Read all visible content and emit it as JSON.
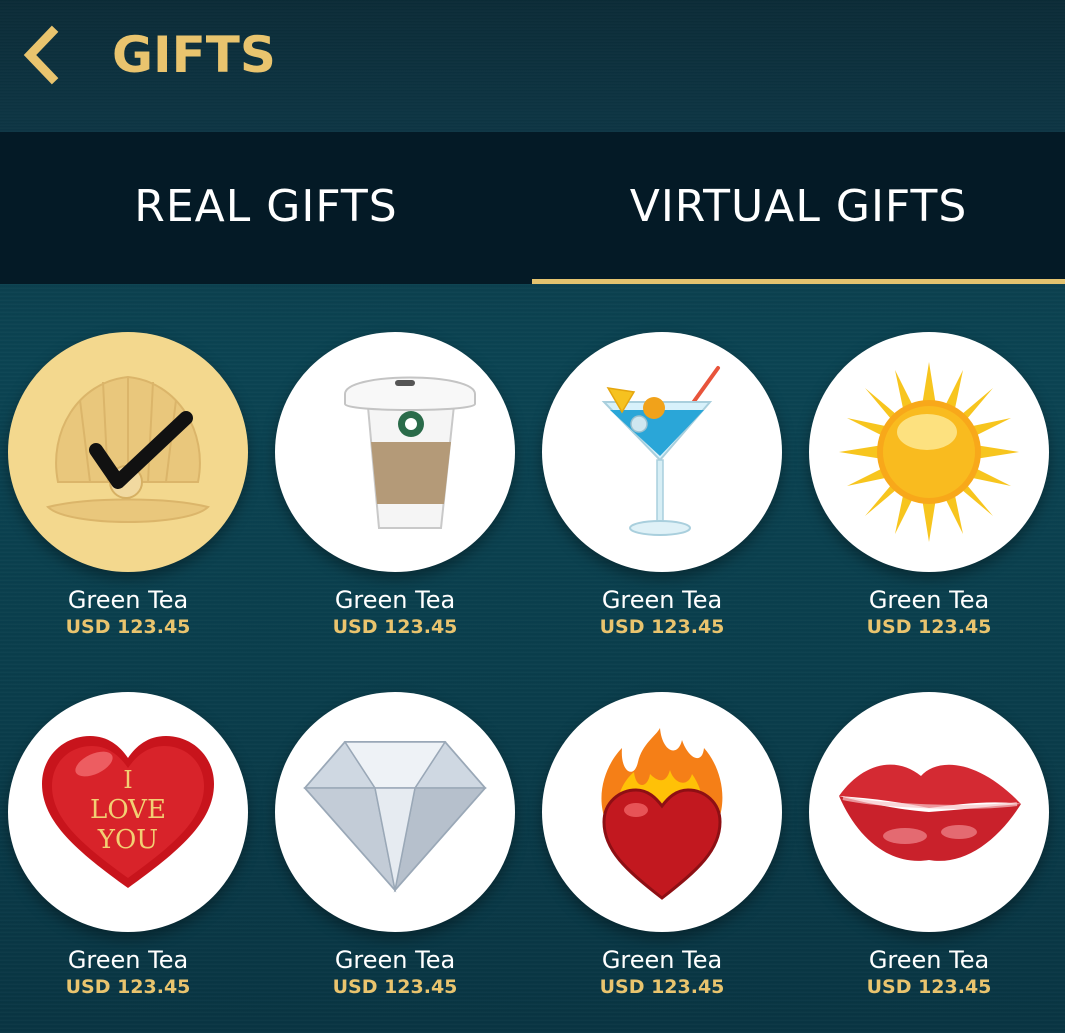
{
  "header": {
    "title": "GIFTS",
    "back_icon": "chevron-left-icon",
    "accent_color": "#e9c46e"
  },
  "tabs": [
    {
      "label": "REAL GIFTS",
      "active": false
    },
    {
      "label": "VIRTUAL GIFTS",
      "active": true
    }
  ],
  "gifts": [
    {
      "icon": "pearl-shell-icon",
      "name": "Green Tea",
      "price": "USD 123.45",
      "selected": true
    },
    {
      "icon": "coffee-cup-icon",
      "name": "Green Tea",
      "price": "USD 123.45",
      "selected": false
    },
    {
      "icon": "cocktail-icon",
      "name": "Green Tea",
      "price": "USD 123.45",
      "selected": false
    },
    {
      "icon": "sun-icon",
      "name": "Green Tea",
      "price": "USD 123.45",
      "selected": false
    },
    {
      "icon": "i-love-you-heart-icon",
      "icon_text": [
        "I",
        "LOVE",
        "YOU"
      ],
      "name": "Green Tea",
      "price": "USD 123.45",
      "selected": false
    },
    {
      "icon": "diamond-icon",
      "name": "Green Tea",
      "price": "USD 123.45",
      "selected": false
    },
    {
      "icon": "flaming-heart-icon",
      "name": "Green Tea",
      "price": "USD 123.45",
      "selected": false
    },
    {
      "icon": "lips-kiss-icon",
      "name": "Green Tea",
      "price": "USD 123.45",
      "selected": false
    }
  ]
}
